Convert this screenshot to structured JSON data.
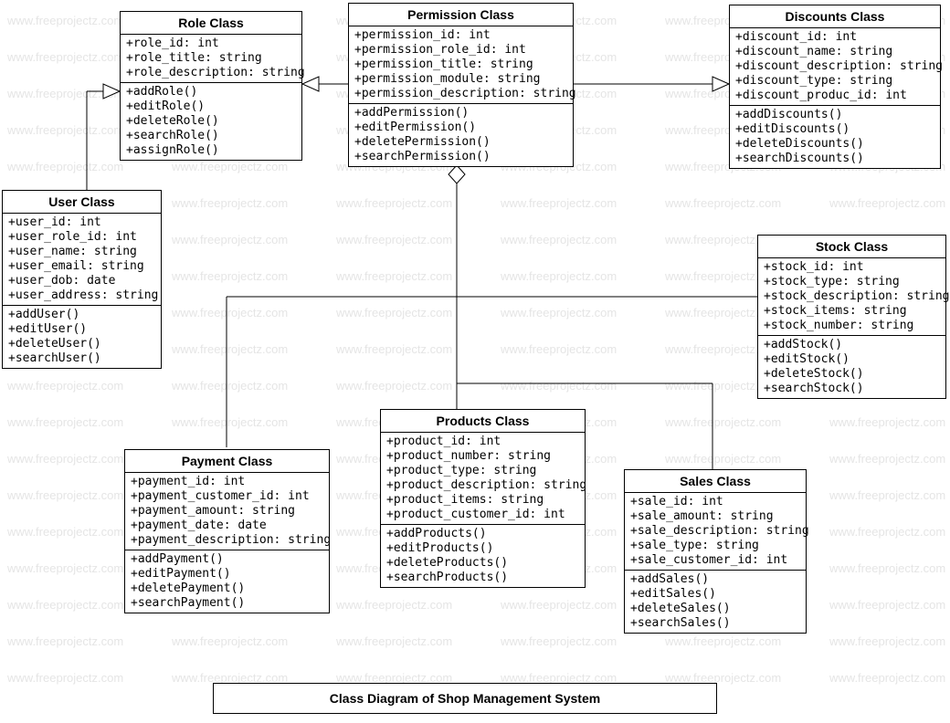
{
  "diagram_title": "Class Diagram of Shop Management System",
  "watermark_text": "www.freeprojectz.com",
  "classes": {
    "role": {
      "name": "Role Class",
      "attributes": [
        "+role_id: int",
        "+role_title: string",
        "+role_description: string"
      ],
      "methods": [
        "+addRole()",
        "+editRole()",
        "+deleteRole()",
        "+searchRole()",
        "+assignRole()"
      ]
    },
    "permission": {
      "name": "Permission Class",
      "attributes": [
        "+permission_id: int",
        "+permission_role_id: int",
        "+permission_title: string",
        "+permission_module: string",
        "+permission_description: string"
      ],
      "methods": [
        "+addPermission()",
        "+editPermission()",
        "+deletePermission()",
        "+searchPermission()"
      ]
    },
    "discounts": {
      "name": "Discounts Class",
      "attributes": [
        "+discount_id: int",
        "+discount_name: string",
        "+discount_description: string",
        "+discount_type: string",
        "+discount_produc_id: int"
      ],
      "methods": [
        "+addDiscounts()",
        "+editDiscounts()",
        "+deleteDiscounts()",
        "+searchDiscounts()"
      ]
    },
    "user": {
      "name": "User Class",
      "attributes": [
        "+user_id: int",
        "+user_role_id: int",
        "+user_name: string",
        "+user_email: string",
        "+user_dob: date",
        "+user_address: string"
      ],
      "methods": [
        "+addUser()",
        "+editUser()",
        "+deleteUser()",
        "+searchUser()"
      ]
    },
    "stock": {
      "name": "Stock Class",
      "attributes": [
        "+stock_id: int",
        "+stock_type: string",
        "+stock_description: string",
        "+stock_items: string",
        "+stock_number: string"
      ],
      "methods": [
        "+addStock()",
        "+editStock()",
        "+deleteStock()",
        "+searchStock()"
      ]
    },
    "products": {
      "name": "Products  Class",
      "attributes": [
        "+product_id: int",
        "+product_number: string",
        "+product_type: string",
        "+product_description: string",
        "+product_items: string",
        "+product_customer_id: int"
      ],
      "methods": [
        "+addProducts()",
        "+editProducts()",
        "+deleteProducts()",
        "+searchProducts()"
      ]
    },
    "payment": {
      "name": "Payment Class",
      "attributes": [
        "+payment_id: int",
        "+payment_customer_id: int",
        "+payment_amount: string",
        "+payment_date: date",
        "+payment_description: string"
      ],
      "methods": [
        "+addPayment()",
        "+editPayment()",
        "+deletePayment()",
        "+searchPayment()"
      ]
    },
    "sales": {
      "name": "Sales Class",
      "attributes": [
        "+sale_id: int",
        "+sale_amount: string",
        "+sale_description: string",
        "+sale_type: string",
        "+sale_customer_id: int"
      ],
      "methods": [
        "+addSales()",
        "+editSales()",
        "+deleteSales()",
        "+searchSales()"
      ]
    }
  }
}
